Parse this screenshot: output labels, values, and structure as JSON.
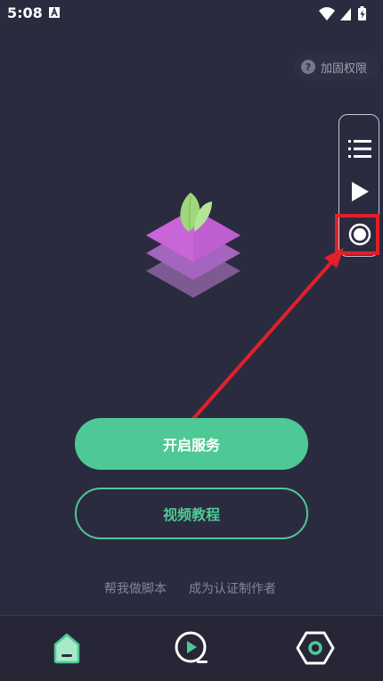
{
  "status_bar": {
    "time": "5:08",
    "notification_icon": "a-letter-icon",
    "wifi_icon": "wifi-icon",
    "signal_icon": "signal-icon",
    "battery_icon": "battery-charging-icon"
  },
  "header": {
    "permission_label": "加固权限",
    "permission_icon": "question-circle-icon"
  },
  "floating_panel": {
    "items": [
      {
        "icon": "list-icon"
      },
      {
        "icon": "play-icon"
      },
      {
        "icon": "record-icon"
      }
    ],
    "highlight_color": "#e0202a"
  },
  "main": {
    "logo_icon": "layered-leaf-logo",
    "start_service_label": "开启服务",
    "video_tutorial_label": "视频教程",
    "links": [
      "帮我做脚本",
      "成为认证制作者"
    ]
  },
  "bottom_nav": {
    "items": [
      {
        "icon": "home-icon",
        "active": true
      },
      {
        "icon": "video-icon",
        "active": false
      },
      {
        "icon": "settings-icon",
        "active": false
      }
    ]
  },
  "colors": {
    "background": "#2b2b3f",
    "accent": "#4ec995",
    "arrow": "#e0202a"
  }
}
